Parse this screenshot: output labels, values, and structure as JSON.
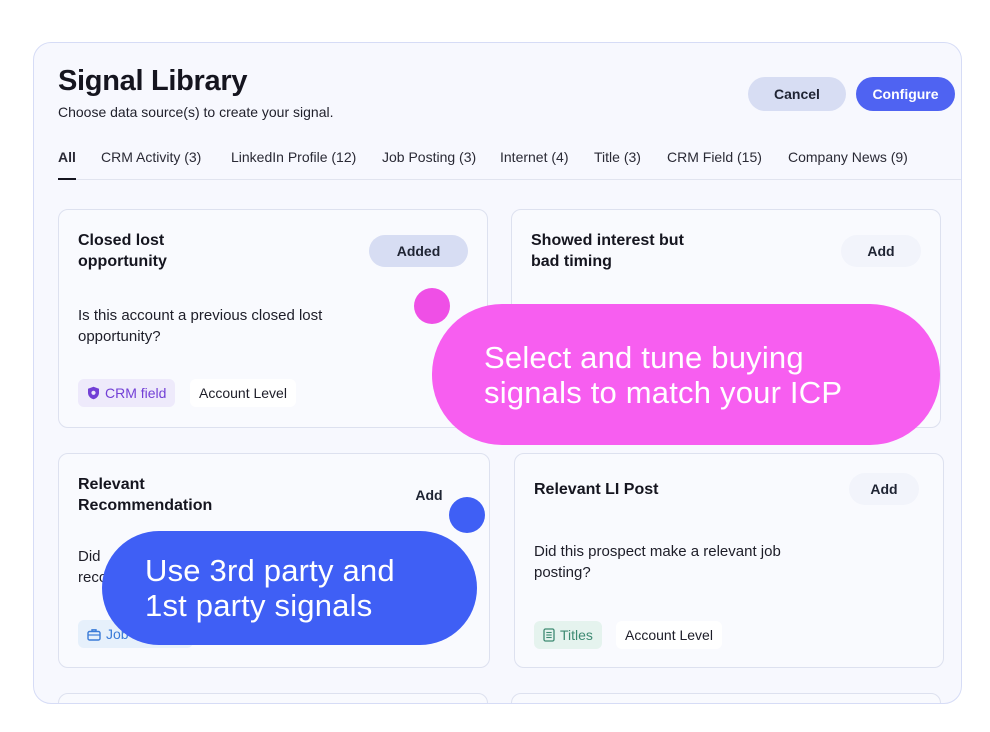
{
  "header": {
    "title": "Signal Library",
    "subtitle": "Choose data source(s) to create your signal.",
    "cancel_label": "Cancel",
    "configure_label": "Configure"
  },
  "tabs": [
    {
      "label": "All",
      "active": true
    },
    {
      "label": "CRM Activity (3)"
    },
    {
      "label": "LinkedIn Profile (12)"
    },
    {
      "label": "Job Posting (3)"
    },
    {
      "label": "Internet (4)"
    },
    {
      "label": "Title (3)"
    },
    {
      "label": "CRM Field (15)"
    },
    {
      "label": "Company News (9)"
    }
  ],
  "cards": {
    "closed_lost": {
      "title_line1": "Closed lost",
      "title_line2": "opportunity",
      "button": "Added",
      "body_line1": "Is this account a previous closed lost",
      "body_line2": "opportunity?",
      "tag_source": "CRM field",
      "tag_level": "Account Level",
      "tag_icon": "shield-icon"
    },
    "showed_interest": {
      "title_line1": "Showed interest but",
      "title_line2": "bad timing",
      "button": "Add"
    },
    "relevant_recommendation": {
      "title_line1": "Relevant",
      "title_line2": "Recommendation",
      "button": "Add",
      "body_line1": "Did",
      "body_line2": "reco",
      "tag_source": "Job",
      "tag_icon": "briefcase-icon"
    },
    "relevant_li_post": {
      "title": "Relevant LI Post",
      "button": "Add",
      "body_line1": "Did this prospect make a relevant job",
      "body_line2": "posting?",
      "tag_source": "Titles",
      "tag_level": "Account Level",
      "tag_icon": "document-icon"
    }
  },
  "callouts": {
    "pink_line1": "Select and tune buying",
    "pink_line2": "signals to match your ICP",
    "blue_line1": "Use 3rd party and",
    "blue_line2": "1st party signals"
  },
  "colors": {
    "accent_blue": "#4f63f2",
    "callout_pink": "#f75ef0",
    "callout_pink_dot": "#ef4fe6",
    "callout_blue": "#3f5ff5",
    "tag_purple": "#7340d6",
    "tag_blue": "#3a7bd8",
    "tag_green": "#3d8a72"
  }
}
